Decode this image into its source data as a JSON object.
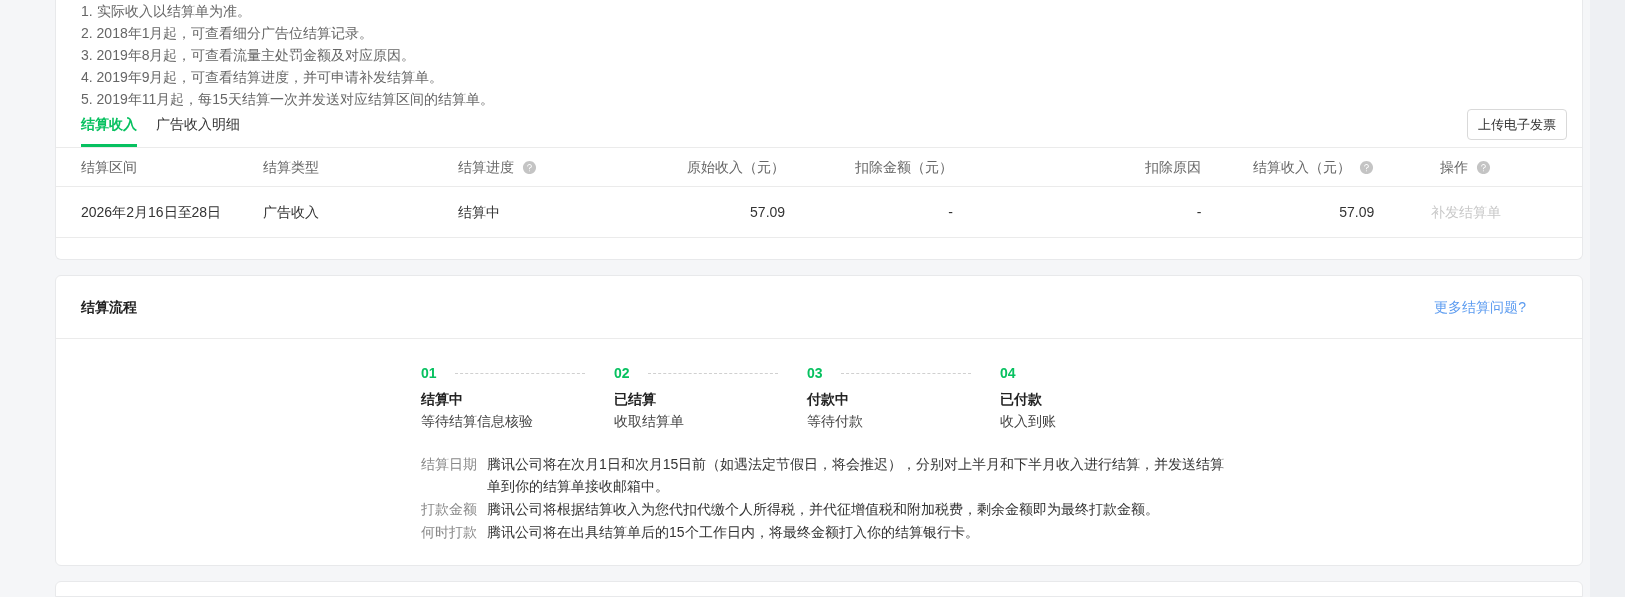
{
  "notes": [
    "1. 实际收入以结算单为准。",
    "2. 2018年1月起，可查看细分广告位结算记录。",
    "3. 2019年8月起，可查看流量主处罚金额及对应原因。",
    "4. 2019年9月起，可查看结算进度，并可申请补发结算单。",
    "5. 2019年11月起，每15天结算一次并发送对应结算区间的结算单。"
  ],
  "tabs": [
    {
      "label": "结算收入",
      "selected": true
    },
    {
      "label": "广告收入明细",
      "selected": false
    }
  ],
  "upload_button": "上传电子发票",
  "table": {
    "columns": [
      {
        "label": "结算区间",
        "help": false
      },
      {
        "label": "结算类型",
        "help": false
      },
      {
        "label": "结算进度",
        "help": true
      },
      {
        "label": "原始收入（元）",
        "help": false
      },
      {
        "label": "扣除金额（元）",
        "help": false
      },
      {
        "label": "扣除原因",
        "help": false
      },
      {
        "label": "结算收入（元）",
        "help": true
      },
      {
        "label": "操作",
        "help": true
      }
    ],
    "rows": [
      {
        "cells": [
          "2026年2月16日至28日",
          "广告收入",
          "结算中",
          "57.09",
          "-",
          "-",
          "57.09"
        ],
        "action": {
          "label": "补发结算单",
          "disabled": true
        }
      }
    ]
  },
  "process": {
    "title": "结算流程",
    "link": "更多结算问题?",
    "steps": [
      {
        "number": "01",
        "title": "结算中",
        "description": "等待结算信息核验"
      },
      {
        "number": "02",
        "title": "已结算",
        "description": "收取结算单"
      },
      {
        "number": "03",
        "title": "付款中",
        "description": "等待付款"
      },
      {
        "number": "04",
        "title": "已付款",
        "description": "收入到账"
      }
    ],
    "info": [
      {
        "label": "结算日期",
        "text": "腾讯公司将在次月1日和次月15日前（如遇法定节假日，将会推迟），分别对上半月和下半月收入进行结算，并发送结算单到你的结算单接收邮箱中。"
      },
      {
        "label": "打款金额",
        "text": "腾讯公司将根据结算收入为您代扣代缴个人所得税，并代征增值税和附加税费，剩余金额即为最终打款金额。"
      },
      {
        "label": "何时打款",
        "text": "腾讯公司将在出具结算单后的15个工作日内，将最终金额打入你的结算银行卡。"
      }
    ]
  }
}
